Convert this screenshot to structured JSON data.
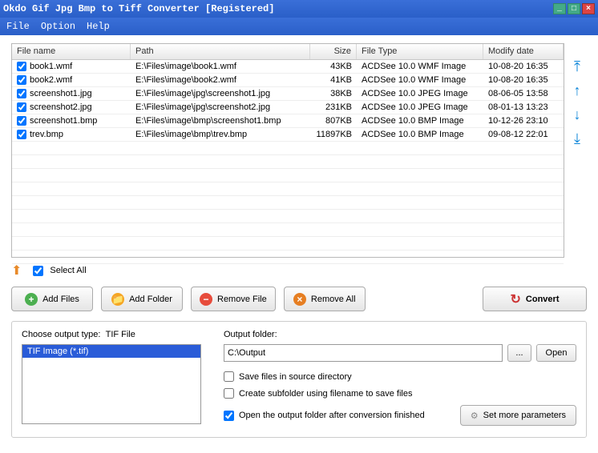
{
  "title": "Okdo Gif Jpg Bmp to Tiff Converter [Registered]",
  "menu": {
    "file": "File",
    "option": "Option",
    "help": "Help"
  },
  "cols": {
    "name": "File name",
    "path": "Path",
    "size": "Size",
    "type": "File Type",
    "date": "Modify date"
  },
  "rows": [
    {
      "name": "book1.wmf",
      "path": "E:\\Files\\image\\book1.wmf",
      "size": "43KB",
      "type": "ACDSee 10.0 WMF Image",
      "date": "10-08-20 16:35"
    },
    {
      "name": "book2.wmf",
      "path": "E:\\Files\\image\\book2.wmf",
      "size": "41KB",
      "type": "ACDSee 10.0 WMF Image",
      "date": "10-08-20 16:35"
    },
    {
      "name": "screenshot1.jpg",
      "path": "E:\\Files\\image\\jpg\\screenshot1.jpg",
      "size": "38KB",
      "type": "ACDSee 10.0 JPEG Image",
      "date": "08-06-05 13:58"
    },
    {
      "name": "screenshot2.jpg",
      "path": "E:\\Files\\image\\jpg\\screenshot2.jpg",
      "size": "231KB",
      "type": "ACDSee 10.0 JPEG Image",
      "date": "08-01-13 13:23"
    },
    {
      "name": "screenshot1.bmp",
      "path": "E:\\Files\\image\\bmp\\screenshot1.bmp",
      "size": "807KB",
      "type": "ACDSee 10.0 BMP Image",
      "date": "10-12-26 23:10"
    },
    {
      "name": "trev.bmp",
      "path": "E:\\Files\\image\\bmp\\trev.bmp",
      "size": "11897KB",
      "type": "ACDSee 10.0 BMP Image",
      "date": "09-08-12 22:01"
    }
  ],
  "selectAll": "Select All",
  "buttons": {
    "addFiles": "Add Files",
    "addFolder": "Add Folder",
    "removeFile": "Remove File",
    "removeAll": "Remove All",
    "convert": "Convert"
  },
  "outputTypeLabel": "Choose output type:",
  "outputTypeCurrent": "TIF File",
  "outputTypeItem": "TIF Image (*.tif)",
  "outputFolderLabel": "Output folder:",
  "outputFolder": "C:\\Output",
  "browse": "...",
  "open": "Open",
  "chk1": "Save files in source directory",
  "chk2": "Create subfolder using filename to save files",
  "chk3": "Open the output folder after conversion finished",
  "moreParams": "Set more parameters"
}
